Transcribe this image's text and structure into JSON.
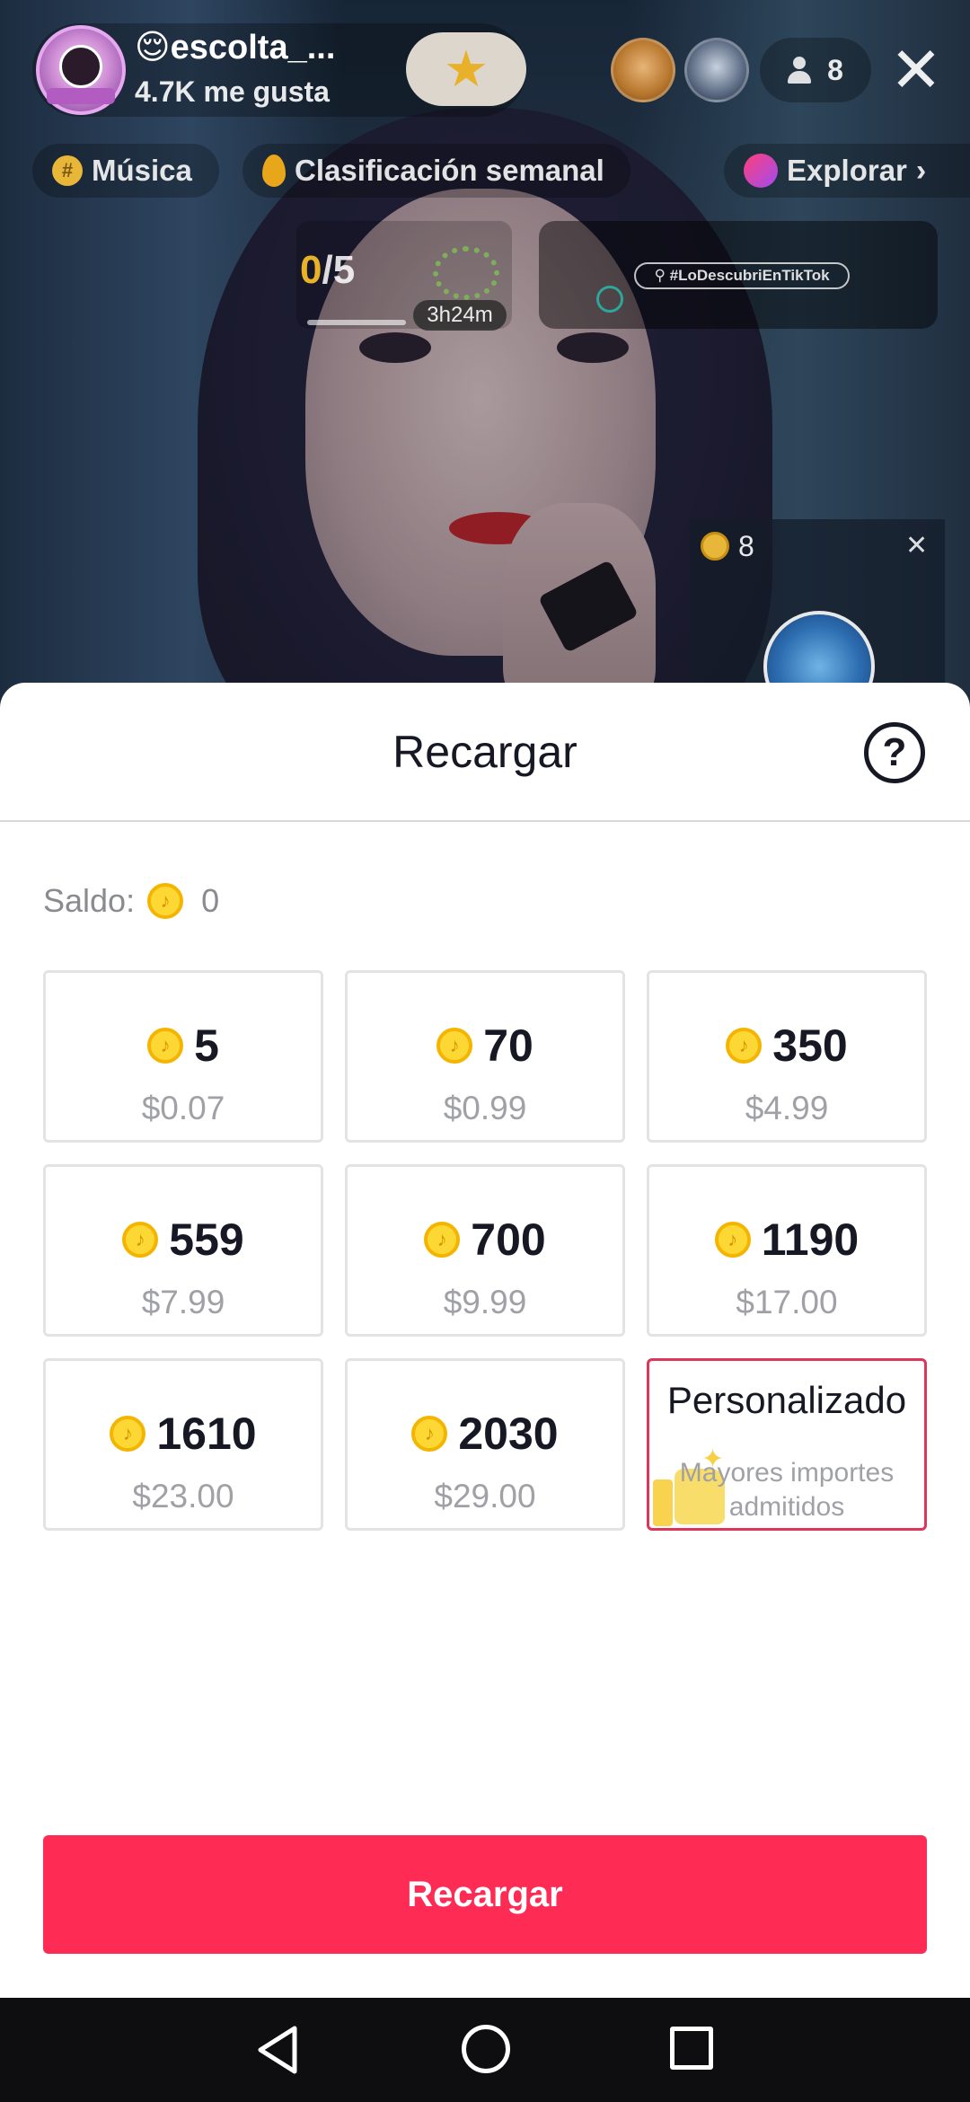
{
  "stream": {
    "host_emoji": "😌",
    "host_name": "escolta_...",
    "host_likes": "4.7K me gusta",
    "viewer_count": "8",
    "chips": {
      "music": "Música",
      "ranking": "Clasificación semanal",
      "explore": "Explorar"
    },
    "goal": {
      "current": "0",
      "total": "/5",
      "timer": "3h24m"
    },
    "hashtag": "#LoDescubriEnTikTok",
    "gift_count": "8"
  },
  "sheet": {
    "title": "Recargar",
    "balance_label": "Saldo:",
    "balance_value": "0",
    "packages": [
      {
        "coins": "5",
        "price": "$0.07"
      },
      {
        "coins": "70",
        "price": "$0.99"
      },
      {
        "coins": "350",
        "price": "$4.99"
      },
      {
        "coins": "559",
        "price": "$7.99"
      },
      {
        "coins": "700",
        "price": "$9.99"
      },
      {
        "coins": "1190",
        "price": "$17.00"
      },
      {
        "coins": "1610",
        "price": "$23.00"
      },
      {
        "coins": "2030",
        "price": "$29.00"
      }
    ],
    "custom": {
      "title": "Personalizado",
      "subtitle": "Mayores importes admitidos"
    },
    "button_label": "Recargar"
  },
  "colors": {
    "accent": "#fe2c55",
    "coin": "#fdd835",
    "custom_border": "#e0355a"
  },
  "icons": [
    "close-icon",
    "question-icon",
    "coin-icon",
    "star-icon",
    "thumbs-up-icon",
    "back-icon",
    "home-icon",
    "recents-icon"
  ]
}
